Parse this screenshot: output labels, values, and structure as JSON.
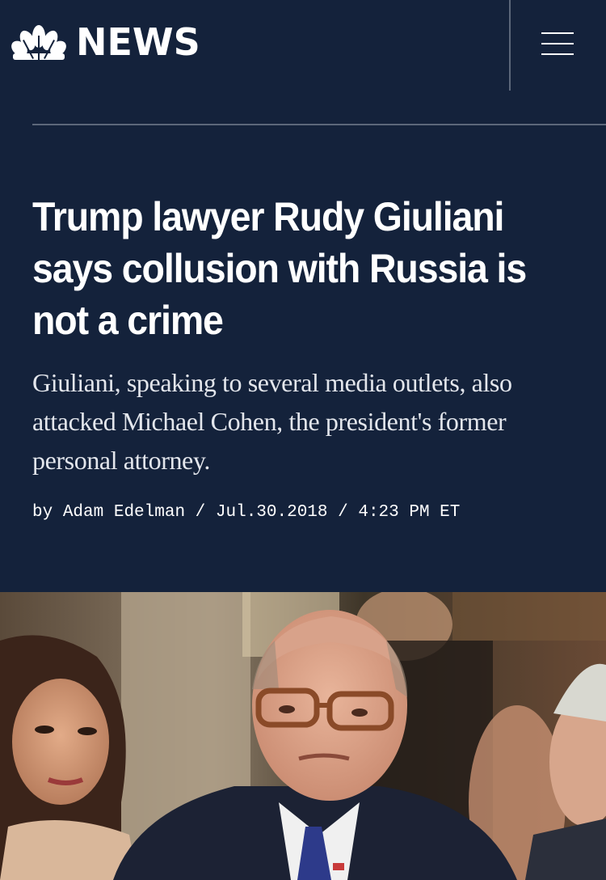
{
  "header": {
    "logo_text": "NEWS",
    "logo_icon": "peacock-icon",
    "menu_icon": "hamburger-menu-icon"
  },
  "article": {
    "headline": "Trump lawyer Rudy Giuliani says collusion with Russia is not a crime",
    "dek": "Giuliani, speaking to several media outlets, also attacked Michael Cohen, the president's former personal attorney.",
    "byline": {
      "prefix": "by",
      "author": "Adam Edelman",
      "separator": "/",
      "date": "Jul.30.2018",
      "time": "4:23 PM ET"
    }
  },
  "colors": {
    "background": "#14223b",
    "text": "#ffffff",
    "dek_text": "#e3e6ec",
    "rule": "#5c677a"
  }
}
